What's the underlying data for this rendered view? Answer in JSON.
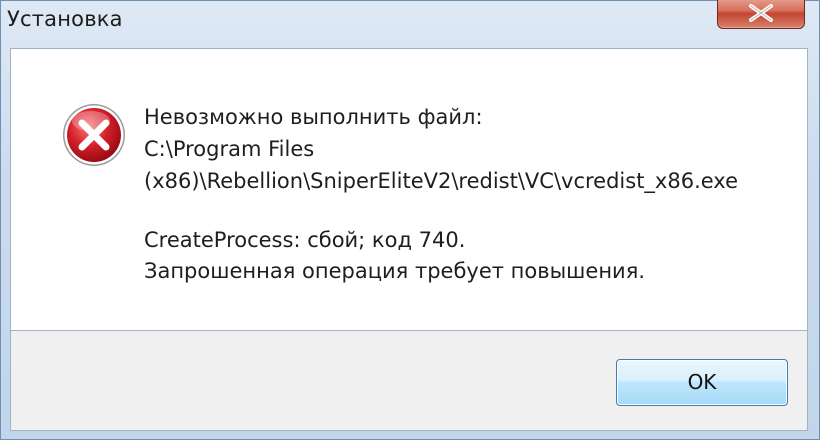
{
  "window": {
    "title": "Установка",
    "close_symbol": "x"
  },
  "dialog": {
    "icon": "error-icon",
    "lines": [
      "Невозможно выполнить файл:",
      "C:\\Program Files",
      "(x86)\\Rebellion\\SniperEliteV2\\redist\\VC\\vcredist_x86.exe",
      "CreateProcess: сбой; код 740.",
      "Запрошенная операция требует повышения."
    ]
  },
  "buttons": {
    "ok_label": "OK"
  },
  "colors": {
    "error_red": "#c8102e",
    "close_button": "#c24630",
    "button_blue": "#3c7fb1"
  }
}
